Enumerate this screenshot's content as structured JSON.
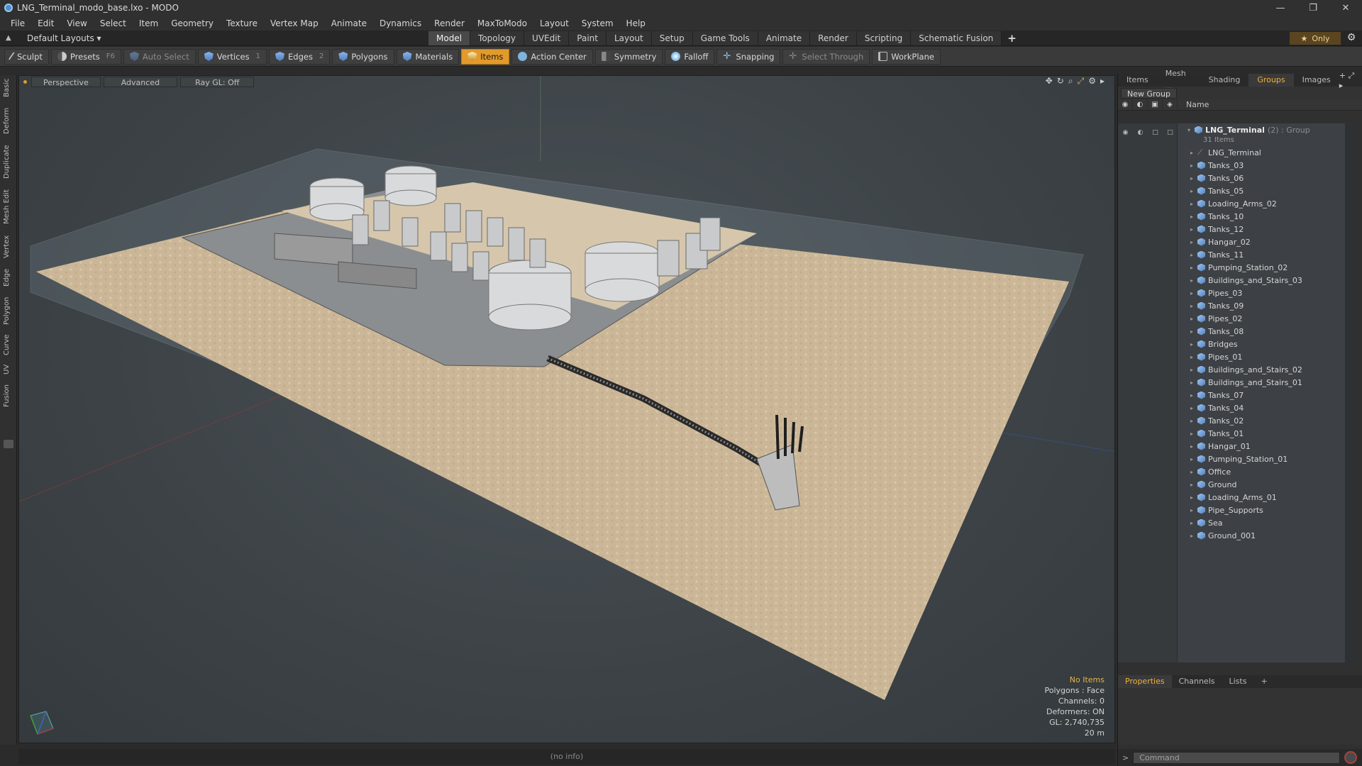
{
  "window": {
    "title": "LNG_Terminal_modo_base.lxo - MODO",
    "controls": [
      "—",
      "❐",
      "✕"
    ]
  },
  "menu": [
    "File",
    "Edit",
    "View",
    "Select",
    "Item",
    "Geometry",
    "Texture",
    "Vertex Map",
    "Animate",
    "Dynamics",
    "Render",
    "MaxToModo",
    "Layout",
    "System",
    "Help"
  ],
  "layout": {
    "default_layouts": "Default Layouts ▾",
    "tabs": [
      "Model",
      "Topology",
      "UVEdit",
      "Paint",
      "Layout",
      "Setup",
      "Game Tools",
      "Animate",
      "Render",
      "Scripting",
      "Schematic Fusion"
    ],
    "active_tab": "Model",
    "plus": "+",
    "only": "Only"
  },
  "toolbar": {
    "sculpt": "Sculpt",
    "presets": "Presets",
    "presets_key": "F6",
    "auto_select": "Auto Select",
    "vertices": "Vertices",
    "vertices_key": "1",
    "edges": "Edges",
    "edges_key": "2",
    "polygons": "Polygons",
    "materials": "Materials",
    "items": "Items",
    "action_center": "Action Center",
    "symmetry": "Symmetry",
    "falloff": "Falloff",
    "snapping": "Snapping",
    "select_through": "Select Through",
    "workplane": "WorkPlane"
  },
  "left_tabs": [
    "Basic",
    "Deform",
    "Duplicate",
    "Mesh Edit",
    "Vertex",
    "Edge",
    "Polygon",
    "Curve",
    "UV",
    "Fusion"
  ],
  "viewport": {
    "perspective": "Perspective",
    "advanced": "Advanced",
    "raygl": "Ray GL: Off",
    "info": {
      "no_items": "No Items",
      "polygons": "Polygons : Face",
      "channels": "Channels: 0",
      "deformers": "Deformers: ON",
      "gl": "GL: 2,740,735",
      "scale": "20 m"
    }
  },
  "status": "(no info)",
  "right_panel": {
    "tabs": [
      "Items",
      "Mesh ...",
      "Shading",
      "Groups",
      "Images"
    ],
    "active_tab": "Groups",
    "new_group": "New Group",
    "name_col": "Name",
    "group": {
      "name": "LNG_Terminal",
      "tail": "(2) : Group",
      "count": "31 Items"
    },
    "items": [
      "LNG_Terminal",
      "Tanks_03",
      "Tanks_06",
      "Tanks_05",
      "Loading_Arms_02",
      "Tanks_10",
      "Tanks_12",
      "Hangar_02",
      "Tanks_11",
      "Pumping_Station_02",
      "Buildings_and_Stairs_03",
      "Pipes_03",
      "Tanks_09",
      "Pipes_02",
      "Tanks_08",
      "Bridges",
      "Pipes_01",
      "Buildings_and_Stairs_02",
      "Buildings_and_Stairs_01",
      "Tanks_07",
      "Tanks_04",
      "Tanks_02",
      "Tanks_01",
      "Hangar_01",
      "Pumping_Station_01",
      "Office",
      "Ground",
      "Loading_Arms_01",
      "Pipe_Supports",
      "Sea",
      "Ground_001"
    ],
    "props_tabs": [
      "Properties",
      "Channels",
      "Lists",
      "+"
    ],
    "props_active": "Properties",
    "command_placeholder": "Command"
  }
}
